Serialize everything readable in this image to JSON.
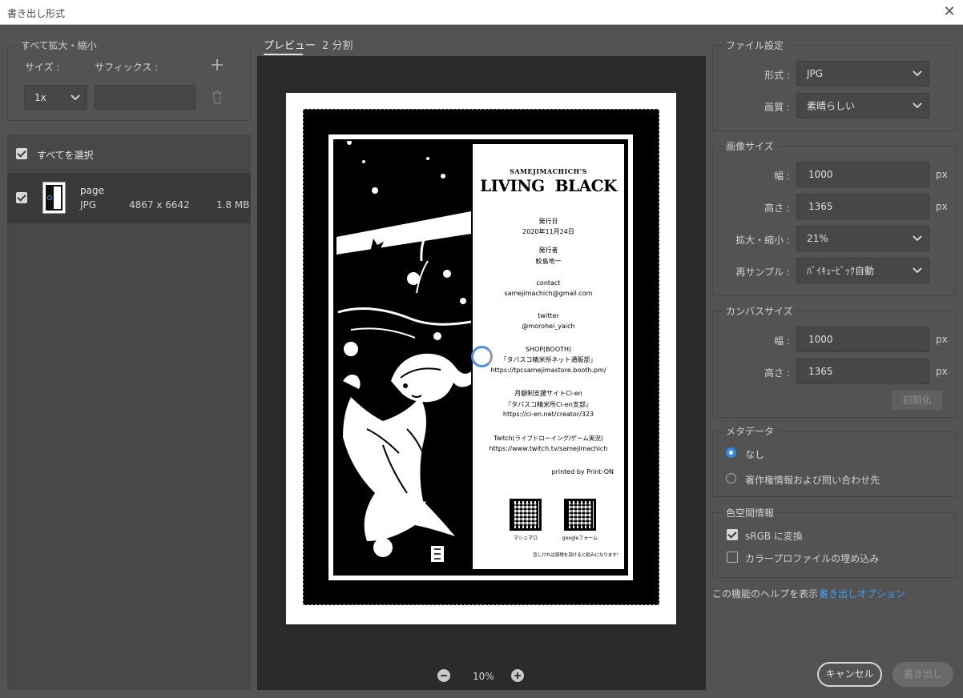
{
  "window": {
    "title": "書き出し形式",
    "close_icon": "close-icon"
  },
  "scale_all": {
    "title": "すべて拡大・縮小",
    "size_label": "サイズ :",
    "suffix_label": "サフィックス :",
    "size_value": "1x",
    "suffix_value": ""
  },
  "assets": {
    "select_all_label": "すべてを選択",
    "items": [
      {
        "name": "page",
        "format": "JPG",
        "dimensions": "4867 x 6642",
        "size": "1.8 MB"
      }
    ]
  },
  "tabs": {
    "preview": "プレビュー",
    "split": "2 分割"
  },
  "zoom": {
    "value": "10%"
  },
  "poster": {
    "kicker": "SAMEJIMACHICH'S",
    "title": "LIVING  BLACK",
    "lines": [
      "発行日",
      "2020年11月24日",
      "発行者",
      "鮫島地一",
      "contact",
      "samejimachich@gmail.com",
      "twitter",
      "@morohei_yaich",
      "SHOP(BOOTH)",
      "「タバスコ精米所ネット通販部」",
      "https://tpcsamejimastore.booth.pm/",
      "月額制支援サイトCi-en",
      "『タバスコ精米所Ci-en支部』",
      "https://ci-en.net/creator/323",
      "Twitch(ライブドローイング/ゲーム実況)",
      "https://www.twitch.tv/samejimachich",
      "printed by Print-ON"
    ],
    "qr1_caption": "マシュマロ",
    "qr2_caption": "googleフォーム",
    "footer": "宜しければ感想を頂けると励みになります!"
  },
  "file_settings": {
    "title": "ファイル設定",
    "format_label": "形式 :",
    "format_value": "JPG",
    "quality_label": "画質 :",
    "quality_value": "素晴らしい"
  },
  "image_size": {
    "title": "画像サイズ",
    "width_label": "幅 :",
    "width_value": "1000",
    "height_label": "高さ :",
    "height_value": "1365",
    "unit": "px",
    "scale_label": "拡大・縮小 :",
    "scale_value": "21%",
    "resample_label": "再サンプル :",
    "resample_value": "ﾊﾞｲｷｭｰﾋﾞｯｸ自動"
  },
  "canvas_size": {
    "title": "カンバスサイズ",
    "width_label": "幅 :",
    "width_value": "1000",
    "height_label": "高さ :",
    "height_value": "1365",
    "unit": "px",
    "reset_label": "初期化"
  },
  "metadata": {
    "title": "メタデータ",
    "option_none": "なし",
    "option_copyright": "著作権情報および問い合わせ先",
    "selected": "なし"
  },
  "color_space": {
    "title": "色空間情報",
    "srgb_label": "sRGB に変換",
    "srgb_checked": true,
    "embed_label": "カラープロファイルの埋め込み",
    "embed_checked": false
  },
  "help": {
    "prefix": "この機能のヘルプを表示 :",
    "link": "書き出しオプション"
  },
  "buttons": {
    "cancel": "キャンセル",
    "export": "書き出し"
  },
  "colors": {
    "accent": "#2f87e8",
    "link": "#3d9cf5",
    "panel": "#535353",
    "canvas": "#2b2b2b"
  }
}
